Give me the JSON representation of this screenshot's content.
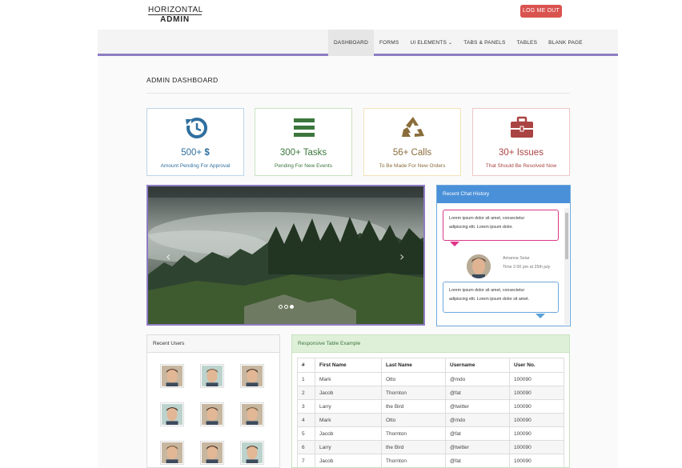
{
  "logo": {
    "line1": "HORIZONTAL",
    "line2": "ADMIN"
  },
  "header": {
    "logout_label": "LOG ME OUT"
  },
  "nav": {
    "items": [
      "DASHBOARD",
      "FORMS",
      "UI ELEMENTS",
      "TABS & PANELS",
      "TABLES",
      "BLANK PAGE"
    ],
    "active_index": 0
  },
  "page_title": "ADMIN DASHBOARD",
  "stats": [
    {
      "value": "500+",
      "icon": "history-icon",
      "icon_glyph": "$",
      "caption": "Amount Pending For Approval",
      "color": "#2f6f9f"
    },
    {
      "value": "300+ Tasks",
      "icon": "bars-icon",
      "caption": "Pending For New Events",
      "color": "#3c763d"
    },
    {
      "value": "56+ Calls",
      "icon": "recycle-icon",
      "caption": "To Be Made For New Orders",
      "color": "#8a6d3b"
    },
    {
      "value": "30+ Issues",
      "icon": "briefcase-icon",
      "caption": "That Should Be Resolved Now",
      "color": "#a94442"
    }
  ],
  "carousel": {
    "prev_glyph": "‹",
    "next_glyph": "›",
    "slide_count": 3,
    "active_slide": 2
  },
  "chat": {
    "title": "Recent Chat History",
    "messages": [
      {
        "line1": "Lorem ipsum dolor sit amet, consectetur",
        "line2": "adipiscing elit. Lorem ipsum dolor."
      },
      {
        "line1": "Lorem ipsum dolor sit amet, consectetur",
        "line2": "adipiscing elit. Lorem ipsum dolor sit amet."
      }
    ],
    "author": "Amanna Seiar",
    "time": "Time 2:00 pm at 25th july"
  },
  "recent_users": {
    "title": "Recent Users"
  },
  "table": {
    "title": "Responsive Table Example",
    "headers": [
      "#",
      "First Name",
      "Last Name",
      "Username",
      "User No."
    ],
    "rows": [
      [
        "1",
        "Mark",
        "Otto",
        "@mdo",
        "100090"
      ],
      [
        "2",
        "Jacob",
        "Thornton",
        "@fat",
        "100090"
      ],
      [
        "3",
        "Larry",
        "the Bird",
        "@twitter",
        "100090"
      ],
      [
        "4",
        "Mark",
        "Otto",
        "@mdo",
        "100090"
      ],
      [
        "5",
        "Jacob",
        "Thornton",
        "@fat",
        "100090"
      ],
      [
        "6",
        "Larry",
        "the Bird",
        "@twitter",
        "100090"
      ],
      [
        "7",
        "Jacob",
        "Thornton",
        "@fat",
        "100090"
      ]
    ]
  }
}
